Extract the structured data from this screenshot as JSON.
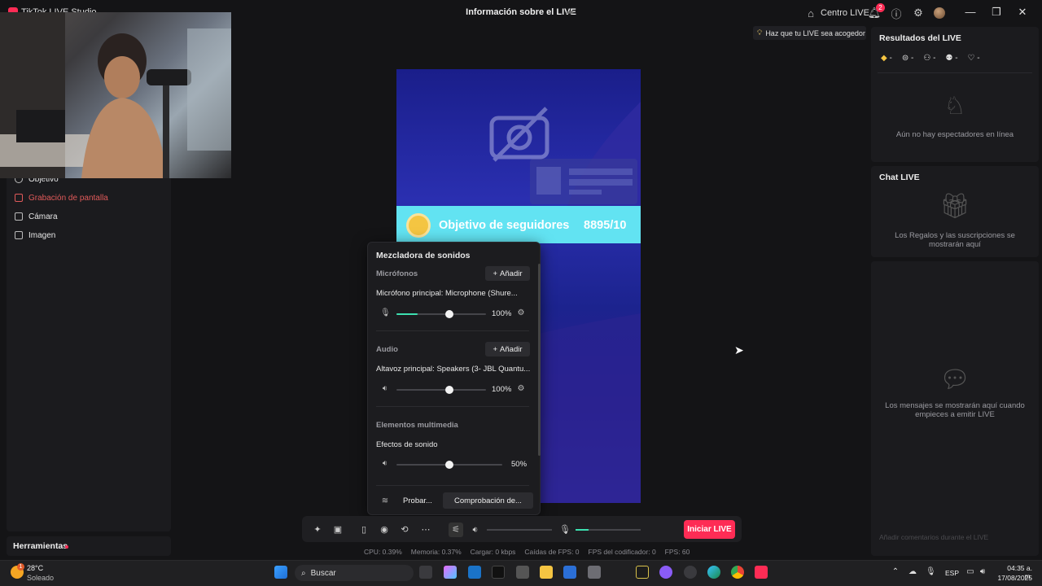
{
  "window": {
    "app_title": "TikTok LIVE Studio",
    "center_title": "Información sobre el LIVE",
    "centro_live": "Centro LIVE",
    "notif_count": "2"
  },
  "left_panel": {
    "sources": [
      {
        "label": "Objetivo",
        "icon": "target-icon",
        "color": "#e6e6e6"
      },
      {
        "label": "Grabación de pantalla",
        "icon": "screen-record-icon",
        "color": "#e05a5a"
      },
      {
        "label": "Cámara",
        "icon": "camera-icon",
        "color": "#e6e6e6"
      },
      {
        "label": "Imagen",
        "icon": "image-icon",
        "color": "#e6e6e6"
      }
    ],
    "tools_label": "Herramientas"
  },
  "preview": {
    "tip": "Haz que tu LIVE sea acogedor",
    "goal_label": "Objetivo de seguidores",
    "goal_count": "8895/10"
  },
  "mixer": {
    "title": "Mezcladora de sonidos",
    "mic_section": "Micrófonos",
    "add_label": "Añadir",
    "mic_device": "Micrófono principal: Microphone (Shure...",
    "mic_volume": "100%",
    "mic_level": 0.24,
    "mic_knob": 0.59,
    "audio_section": "Audio",
    "speaker_device": "Altavoz principal: Speakers (3- JBL Quantu...",
    "speaker_volume": "100%",
    "speaker_knob": 0.59,
    "media_section": "Elementos multimedia",
    "effects_label": "Efectos de sonido",
    "effects_volume": "50%",
    "effects_knob": 0.5,
    "test_label": "Probar...",
    "check_label": "Comprobación de..."
  },
  "controls": {
    "go_live": "Iniciar LIVE",
    "mic_level": 0.2
  },
  "stats": [
    "CPU:  0.39%",
    "Memoria:  0.37%",
    "Cargar:  0 kbps",
    "Caídas de FPS:  0",
    "FPS del codificador:  0",
    "FPS:  60"
  ],
  "right_panel": {
    "results_title": "Resultados del LIVE",
    "stat_values": [
      "-",
      "-",
      "-",
      "-",
      "-"
    ],
    "no_viewers": "Aún no hay espectadores en línea",
    "chat_title": "Chat LIVE",
    "gifts_msg": "Los Regalos y las suscripciones se mostrarán aquí",
    "messages_msg": "Los mensajes se mostrarán aquí cuando empieces a emitir LIVE",
    "comment_placeholder": "Añadir comentarios durante el LIVE"
  },
  "taskbar": {
    "weather_temp": "28°C",
    "weather_cond": "Soleado",
    "weather_badge": "1",
    "search_placeholder": "Buscar",
    "lang": "ESP",
    "time": "04:35 a. m.",
    "date": "17/08/2025"
  }
}
